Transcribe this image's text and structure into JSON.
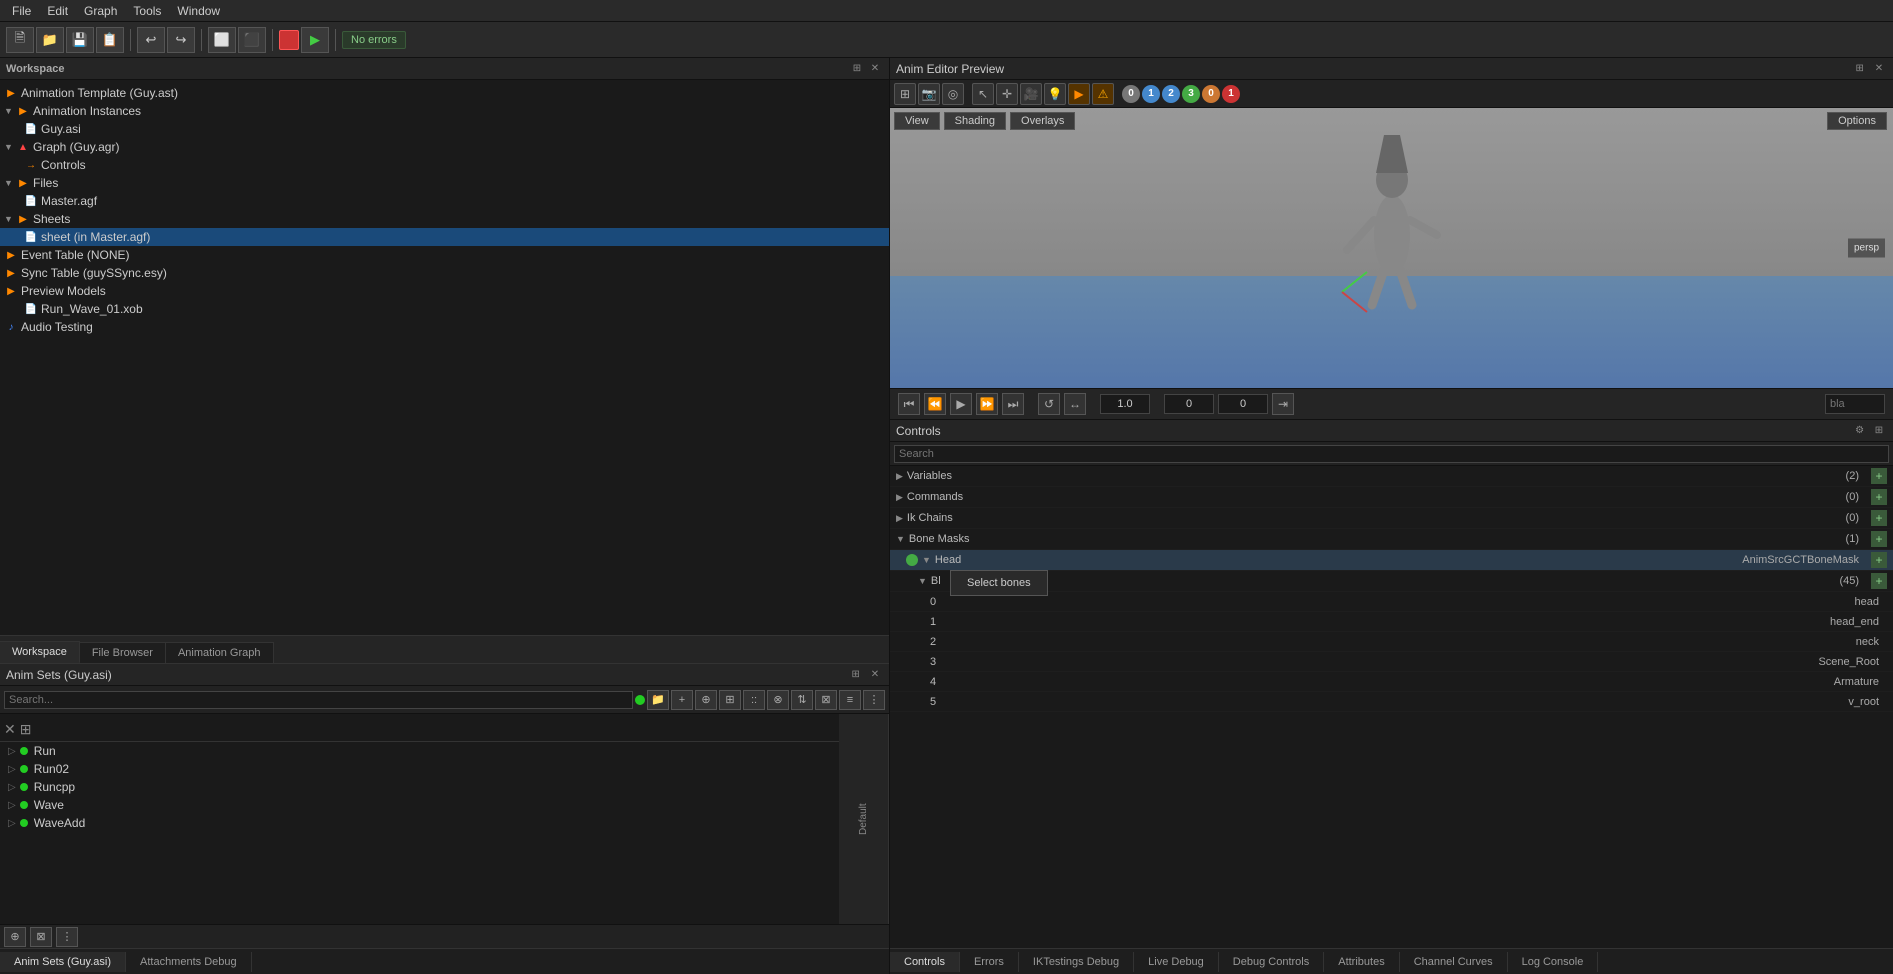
{
  "menubar": {
    "items": [
      "File",
      "Edit",
      "Graph",
      "Tools",
      "Window"
    ]
  },
  "toolbar": {
    "no_errors_label": "No errors"
  },
  "workspace": {
    "title": "Workspace",
    "tree": [
      {
        "id": "animation-template",
        "label": "Animation Template (Guy.ast)",
        "indent": 0,
        "icon": "triangle-orange",
        "chevron": false
      },
      {
        "id": "animation-instances",
        "label": "Animation Instances",
        "indent": 0,
        "icon": "triangle-orange",
        "chevron": true
      },
      {
        "id": "guy-asi",
        "label": "Guy.asi",
        "indent": 1,
        "icon": "file-blue",
        "chevron": false
      },
      {
        "id": "graph-guy",
        "label": "Graph (Guy.agr)",
        "indent": 0,
        "icon": "triangle-red",
        "chevron": true
      },
      {
        "id": "controls",
        "label": "Controls",
        "indent": 1,
        "icon": "arrow-orange",
        "chevron": false
      },
      {
        "id": "files",
        "label": "Files",
        "indent": 0,
        "icon": "triangle-orange",
        "chevron": true
      },
      {
        "id": "master-agf",
        "label": "Master.agf",
        "indent": 1,
        "icon": "file-orange",
        "chevron": false
      },
      {
        "id": "sheets",
        "label": "Sheets",
        "indent": 0,
        "icon": "triangle-orange",
        "chevron": true
      },
      {
        "id": "sheet-master",
        "label": "sheet (in Master.agf)",
        "indent": 2,
        "icon": "file-blue",
        "chevron": false,
        "selected": true
      },
      {
        "id": "event-table",
        "label": "Event Table (NONE)",
        "indent": 0,
        "icon": "triangle-orange",
        "chevron": false
      },
      {
        "id": "sync-table",
        "label": "Sync Table (guySSync.esy)",
        "indent": 0,
        "icon": "triangle-orange",
        "chevron": false
      },
      {
        "id": "preview-models",
        "label": "Preview Models",
        "indent": 0,
        "icon": "triangle-orange",
        "chevron": false
      },
      {
        "id": "run-wave",
        "label": "Run_Wave_01.xob",
        "indent": 1,
        "icon": "file-blue",
        "chevron": false
      },
      {
        "id": "audio-testing",
        "label": "Audio Testing",
        "indent": 0,
        "icon": "music-blue",
        "chevron": false
      }
    ]
  },
  "tabs": {
    "workspace": "Workspace",
    "file_browser": "File Browser",
    "animation_graph": "Animation Graph"
  },
  "anim_sets": {
    "title": "Anim Sets (Guy.asi)",
    "search_placeholder": "Search...",
    "items": [
      {
        "label": "Run",
        "dot": true
      },
      {
        "label": "Run02",
        "dot": true
      },
      {
        "label": "Runcpp",
        "dot": true
      },
      {
        "label": "Wave",
        "dot": true
      },
      {
        "label": "WaveAdd",
        "dot": true
      }
    ],
    "default_col": "Default"
  },
  "anim_editor": {
    "title": "Anim Editor Preview"
  },
  "viewport": {
    "view_btn": "View",
    "shading_btn": "Shading",
    "overlays_btn": "Overlays",
    "options_btn": "Options"
  },
  "playback": {
    "speed": "1.0",
    "pos1": "0",
    "pos2": "0",
    "search_placeholder": "bla"
  },
  "controls": {
    "title": "Controls",
    "search_placeholder": "Search",
    "rows": [
      {
        "label": "Variables",
        "value": "(2)",
        "indent": 0,
        "type": "expandable"
      },
      {
        "label": "Commands",
        "value": "(0)",
        "indent": 0,
        "type": "expandable"
      },
      {
        "label": "Ik Chains",
        "value": "(0)",
        "indent": 0,
        "type": "expandable"
      },
      {
        "label": "Bone Masks",
        "value": "(1)",
        "indent": 0,
        "type": "expandable"
      },
      {
        "label": "Head",
        "value": "AnimSrcGCTBoneMask",
        "indent": 1,
        "type": "bone",
        "has_circle": true
      },
      {
        "label": "Bl",
        "value": "(45)",
        "indent": 2,
        "type": "expandable"
      },
      {
        "label": "0",
        "value": "head",
        "indent": 3,
        "type": "item"
      },
      {
        "label": "1",
        "value": "head_end",
        "indent": 3,
        "type": "item"
      },
      {
        "label": "2",
        "value": "neck",
        "indent": 3,
        "type": "item"
      },
      {
        "label": "3",
        "value": "Scene_Root",
        "indent": 3,
        "type": "item"
      },
      {
        "label": "4",
        "value": "Armature",
        "indent": 3,
        "type": "item"
      },
      {
        "label": "5",
        "value": "v_root",
        "indent": 3,
        "type": "item"
      }
    ]
  },
  "context_menu": {
    "items": [
      "Select bones"
    ]
  },
  "bottom_tabs": [
    {
      "label": "Controls",
      "active": true
    },
    {
      "label": "Errors"
    },
    {
      "label": "IKTestings Debug"
    },
    {
      "label": "Live Debug"
    },
    {
      "label": "Debug Controls"
    },
    {
      "label": "Attributes"
    },
    {
      "label": "Channel Curves",
      "active": false
    },
    {
      "label": "Log Console"
    }
  ],
  "bottom_anim_tabs": [
    {
      "label": "Anim Sets (Guy.asi)",
      "active": true
    },
    {
      "label": "Attachments Debug"
    }
  ],
  "icons": {
    "triangle": "▶",
    "chevron_right": "▶",
    "chevron_down": "▼",
    "close": "✕",
    "folder": "📁",
    "file": "📄",
    "play": "▶",
    "stop": "■",
    "rewind": "⏮",
    "fast_forward": "⏭",
    "step_back": "⏪",
    "step_fwd": "⏩",
    "plus": "+",
    "minus": "−",
    "gear": "⚙"
  },
  "viewport_numbers": [
    {
      "label": "0",
      "color": "num-grey"
    },
    {
      "label": "1",
      "color": "num-blue"
    },
    {
      "label": "2",
      "color": "num-blue"
    },
    {
      "label": "3",
      "color": "num-green"
    },
    {
      "label": "0",
      "color": "num-orange"
    },
    {
      "label": "1",
      "color": "num-red"
    }
  ]
}
